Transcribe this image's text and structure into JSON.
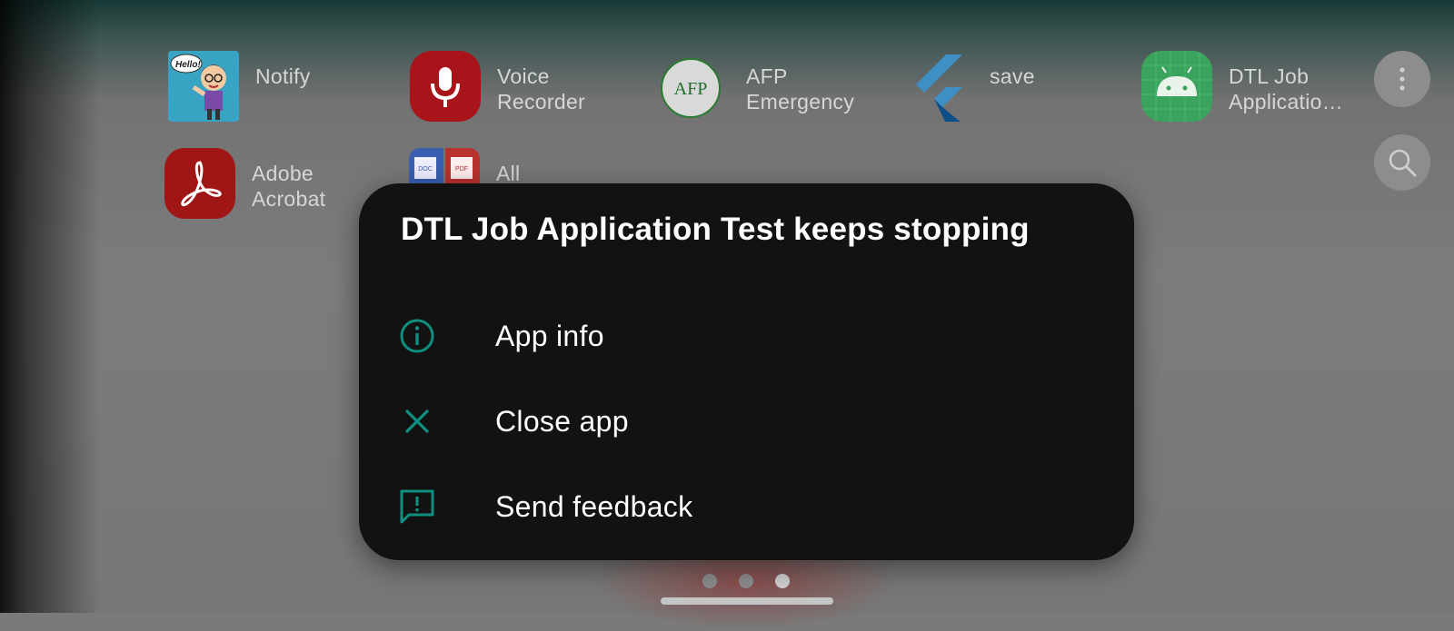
{
  "home": {
    "apps_row1": [
      {
        "label": "Notify",
        "icon": "notify-hello-icon"
      },
      {
        "label": "Voice\nRecorder",
        "icon": "microphone-icon"
      },
      {
        "label": "AFP\nEmergency",
        "icon": "afp-logo-icon"
      },
      {
        "label": "save",
        "icon": "flutter-logo-icon"
      },
      {
        "label": "DTL Job\nApplicatio…",
        "icon": "android-robot-icon"
      }
    ],
    "apps_row2": [
      {
        "label": "Adobe\nAcrobat",
        "icon": "adobe-acrobat-icon"
      },
      {
        "label": "All",
        "icon": "doc-pdf-icon"
      }
    ],
    "notify_bubble_text": "Hello!",
    "afp_logo_text": "AFP",
    "doc_text": "DOC",
    "pdf_text": "PDF",
    "page_indicator": {
      "pages": 3,
      "active": 3
    }
  },
  "dialog": {
    "title": "DTL Job Application Test keeps stopping",
    "options": [
      {
        "label": "App info",
        "icon": "info-icon"
      },
      {
        "label": "Close app",
        "icon": "close-icon"
      },
      {
        "label": "Send feedback",
        "icon": "feedback-icon"
      }
    ],
    "accent_color": "#0f8f80"
  }
}
